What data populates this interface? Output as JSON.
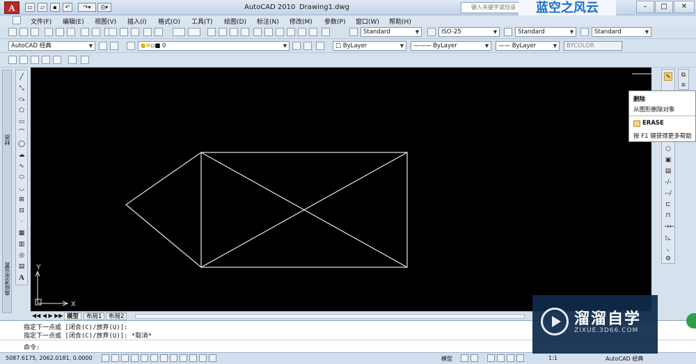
{
  "window": {
    "app_logo": "A",
    "title_app": "AutoCAD 2010",
    "title_file": "Drawing1.dwg",
    "search_placeholder": "键入关键字或短语",
    "brand_overlay": "蓝空之风云",
    "controls": [
      "–",
      "□",
      "✕"
    ]
  },
  "menus": [
    "文件(F)",
    "编辑(E)",
    "视图(V)",
    "插入(I)",
    "格式(O)",
    "工具(T)",
    "绘图(D)",
    "标注(N)",
    "修改(M)",
    "参数(P)",
    "窗口(W)",
    "帮助(H)"
  ],
  "style_toolbar": {
    "text_style": "Standard",
    "dim_style": "ISO-25",
    "table_style": "Standard",
    "multileader_style": "Standard"
  },
  "workspace": {
    "name": "AutoCAD 经典",
    "layer": "0",
    "color": "ByLayer",
    "linetype": "ByLayer",
    "lineweight": "ByLayer",
    "plotstyle": "BYCOLOR"
  },
  "palettes": {
    "left_label_1": "材质",
    "left_label_2": "高级渲染设置"
  },
  "drawing": {
    "axis_y": "Y",
    "axis_x": "X"
  },
  "tooltip": {
    "title": "删除",
    "description": "从图形删除对象",
    "command": "ERASE",
    "help": "按 F1 键获得更多帮助"
  },
  "layout_tabs": [
    "模型",
    "布局1",
    "布局2"
  ],
  "command_line": {
    "history": [
      "指定下一点或 [闭合(C)/放弃(U)]:",
      "指定下一点或 [闭合(C)/放弃(U)]: *取消*"
    ],
    "prompt": "命令:"
  },
  "status_bar": {
    "coordinates": "5087.6175,  2062.0181,  0.0000",
    "model_label": "模型",
    "scale": "1:1",
    "workspace": "AutoCAD 经典"
  },
  "watermark": {
    "name": "溜溜自学",
    "url": "ZIXUE.3D66.COM"
  }
}
